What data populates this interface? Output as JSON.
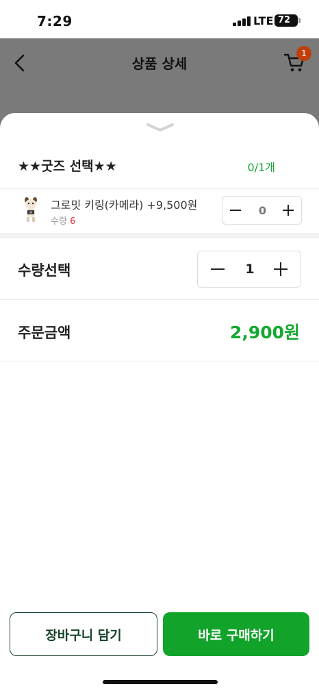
{
  "status_bar": {
    "time": "7:29",
    "network": "LTE",
    "battery": "72"
  },
  "header": {
    "title": "상품 상세",
    "cart_badge": "1",
    "back_icon": "chevron-left-icon",
    "cart_icon": "shopping-cart-icon"
  },
  "goods": {
    "title": "★★굿즈 선택★★",
    "count": "0/1개",
    "option": {
      "name": "그로밋 키링(카메라) +9,500원",
      "qty_label": "수량",
      "qty_value": "6",
      "stepper_value": "0"
    }
  },
  "quantity": {
    "label": "수량선택",
    "value": "1"
  },
  "total": {
    "label": "주문금액",
    "value": "2,900원"
  },
  "actions": {
    "cart_label": "장바구니 담기",
    "buy_label": "바로 구매하기"
  },
  "colors": {
    "accent_green": "#12a32b",
    "cart_border": "#17432a",
    "badge": "#c0400d",
    "stock_red": "#e03030"
  }
}
